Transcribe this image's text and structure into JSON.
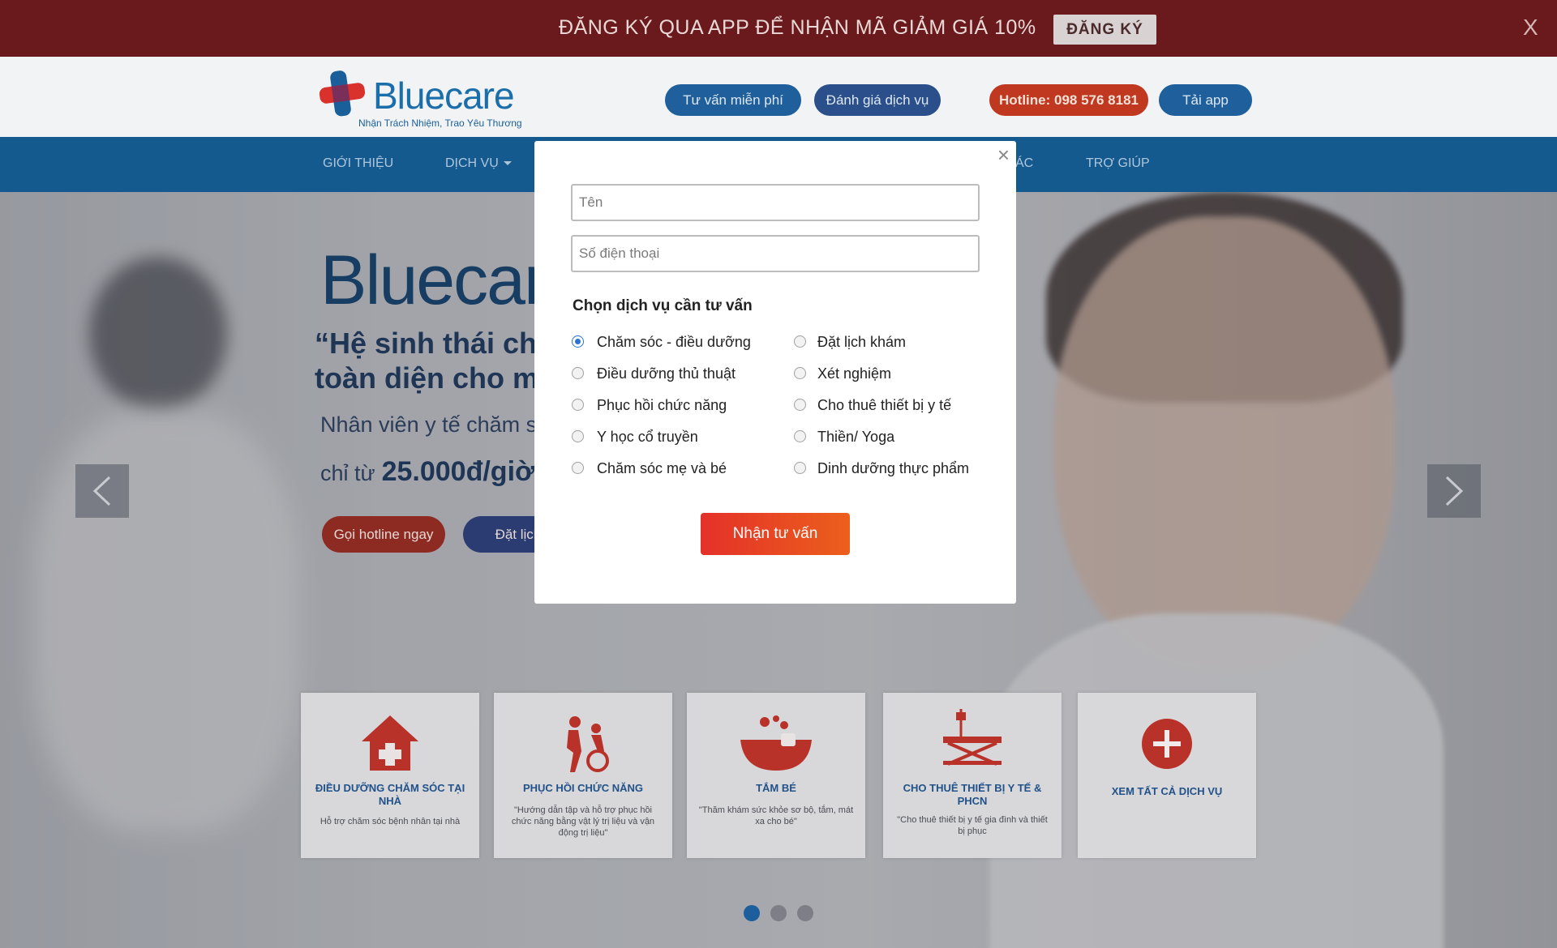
{
  "promo": {
    "text": "ĐĂNG KÝ QUA APP ĐỂ NHẬN MÃ GIẢM GIÁ 10%",
    "button": "ĐĂNG KÝ",
    "close": "X"
  },
  "header": {
    "logo_word": "Bluecare",
    "logo_tagline": "Nhận Trách Nhiệm, Trao Yêu Thương",
    "buttons": [
      "Tư vấn miễn phí",
      "Đánh giá dịch vụ",
      "Hotline: 098 576 8181",
      "Tải app"
    ]
  },
  "nav": {
    "items": [
      "GIỚI THIỆU",
      "DỊCH VỤ",
      "ÁC",
      "TRỢ GIÚP"
    ]
  },
  "hero": {
    "logo_word": "Bluecar",
    "headline_1": "“Hệ sinh thái ch",
    "headline_2": "toàn diện cho m",
    "subtitle": "Nhân viên y tế chăm s",
    "price_prefix": "chỉ từ",
    "price": "25.000đ/giờ",
    "btn_hotline": "Gọi hotline ngay",
    "btn_book": "Đặt lịch o"
  },
  "cards": [
    {
      "title": "ĐIỀU DƯỠNG CHĂM SÓC TẠI NHÀ",
      "desc": "Hỗ trợ chăm sóc bệnh nhân tại nhà",
      "icon": "house-plus-icon"
    },
    {
      "title": "PHỤC HỒI CHỨC NĂNG",
      "desc": "\"Hướng dẫn tập và hỗ trợ phục hồi chức năng bằng vật lý trị liệu và vận động trị liệu\"",
      "icon": "wheelchair-icon"
    },
    {
      "title": "TẮM BÉ",
      "desc": "\"Thăm khám sức khỏe sơ bộ, tắm, mát xa cho bé\"",
      "icon": "baby-bath-icon"
    },
    {
      "title": "CHO THUÊ THIẾT BỊ Y TẾ & PHCN",
      "desc": "\"Cho thuê thiết bị y tế gia đình và thiết bị phục",
      "icon": "hospital-bed-icon"
    },
    {
      "title": "XEM TẤT CẢ DỊCH VỤ",
      "desc": "",
      "icon": "plus-circle-icon"
    }
  ],
  "slider": {
    "active_dot": 0,
    "dot_count": 3
  },
  "modal": {
    "close": "×",
    "name_placeholder": "Tên",
    "phone_placeholder": "Số điện thoại",
    "heading": "Chọn dịch vụ cần tư vấn",
    "options_left": [
      "Chăm sóc - điều dưỡng",
      "Điều dưỡng thủ thuật",
      "Phục hồi chức năng",
      "Y học cổ truyền",
      "Chăm sóc mẹ và bé"
    ],
    "options_right": [
      "Đặt lịch khám",
      "Xét nghiệm",
      "Cho thuê thiết bị y tế",
      "Thiền/ Yoga",
      "Dinh dưỡng thực phẩm"
    ],
    "selected": "Chăm sóc - điều dưỡng",
    "submit": "Nhận tư vấn"
  },
  "colors": {
    "promo_bg": "#6a1a1c",
    "nav_bg": "#155a8f",
    "brand_blue": "#1a6eaa",
    "brand_red": "#e4312a"
  }
}
